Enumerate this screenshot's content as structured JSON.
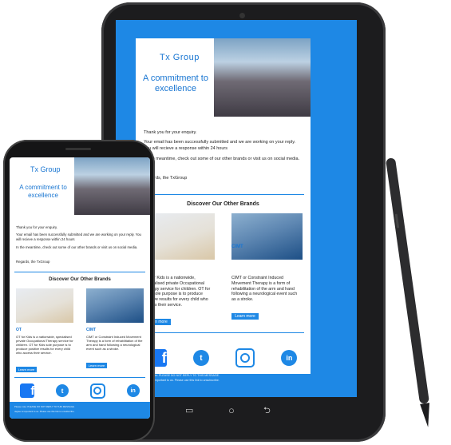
{
  "email": {
    "brand": "Tx Group",
    "tagline": "A commitment to excellence",
    "greeting": "Thank you for your enquiry.",
    "message": "Your email has been successfully submitted and we are working on your reply. You will recieve a response within 24 hours",
    "meantime": "In the meantime, check out some of our other brands or visit us on social media.",
    "signoff": "Regards, the TxGroup",
    "section_title": "Discover Our Other Brands",
    "brands": [
      {
        "name": "OT",
        "description": "OT for Kids is a nationwide, specialised private Occupational Therapy service for children. OT for Kids sole purpose is to produce positive results for every child who access their service.",
        "button": "Learn more"
      },
      {
        "name": "CIMT",
        "description": "CIMT or Constraint Induced Movement Therapy is a form of rehabilitation of the arm and hand following a neurological event such as a stroke.",
        "button": "Learn more"
      }
    ],
    "social": [
      {
        "icon": "facebook-icon",
        "glyph": "f"
      },
      {
        "icon": "twitter-icon",
        "glyph": "t"
      },
      {
        "icon": "instagram-icon",
        "glyph": ""
      },
      {
        "icon": "linkedin-icon",
        "glyph": "in"
      }
    ],
    "footer_note": "Please note: PLEASE DO NOT REPLY TO THIS MESSAGE.",
    "footer_unsub": "Jaylee is important to us. Please use this link to unsubscribe."
  },
  "tablet_nav": {
    "recent": "▭",
    "home": "○",
    "back": "⮌"
  },
  "colors": {
    "accent": "#1e88e5",
    "link": "#1976d2",
    "device": "#1c1c1e"
  }
}
